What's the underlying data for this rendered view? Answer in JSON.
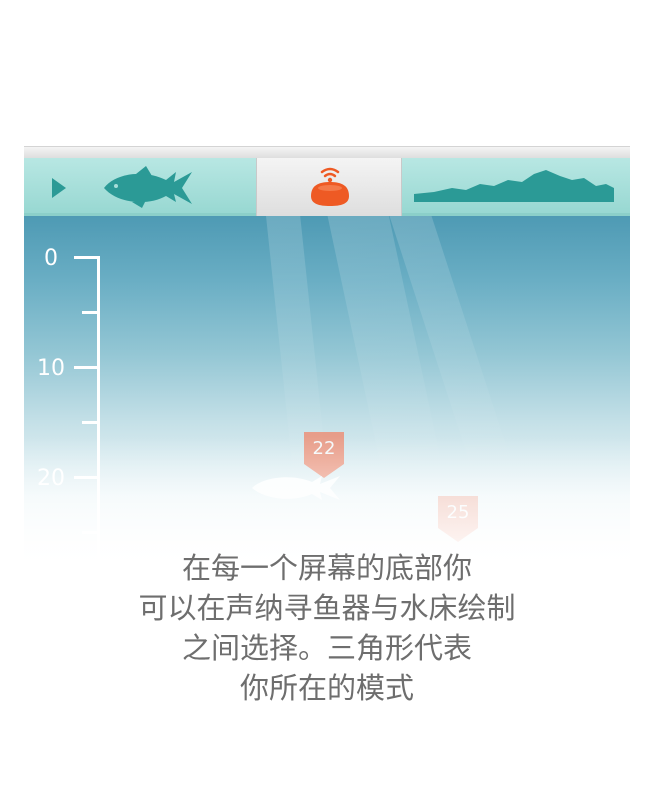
{
  "tabs": [
    {
      "icon": "fish-icon",
      "mode": "fish"
    },
    {
      "icon": "sonar-device-icon",
      "mode": "sonar"
    },
    {
      "icon": "bottom-contour-icon",
      "mode": "bottom"
    }
  ],
  "depth_scale": {
    "labels": [
      "0",
      "10",
      "20"
    ]
  },
  "fish_markers": [
    {
      "depth_label": "22"
    },
    {
      "depth_label": "25"
    }
  ],
  "caption": {
    "lines": [
      "在每一个屏幕的底部你",
      "可以在声纳寻鱼器与水床绘制",
      "之间选择。三角形代表",
      "你所在的模式"
    ]
  },
  "colors": {
    "accent_orange": "#ee5a24",
    "tab_teal": "#a6ded9",
    "icon_teal": "#2b9a96",
    "caption_text": "#6e6e6e"
  }
}
